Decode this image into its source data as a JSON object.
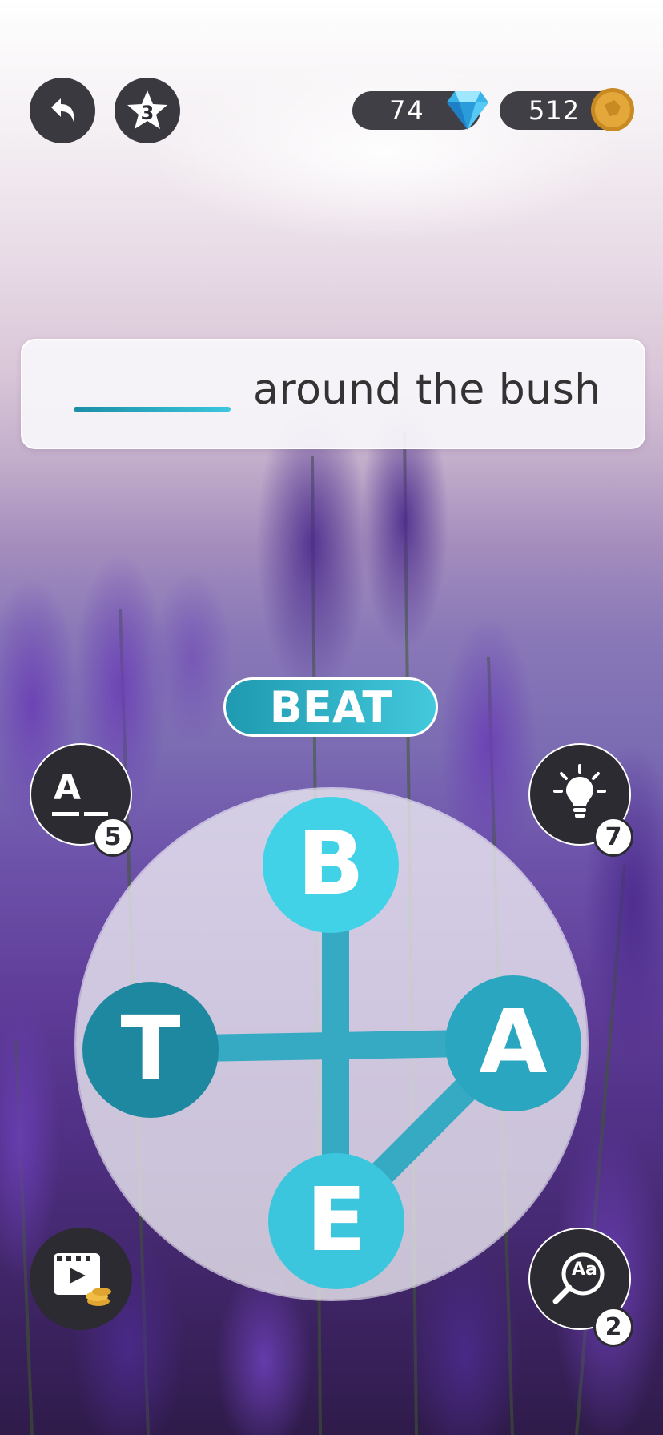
{
  "top_bar": {
    "undo_icon": "undo-arrow-icon",
    "star_level": "3",
    "gems": "74",
    "coins": "512"
  },
  "clue": {
    "text": "around the bush"
  },
  "current_word": "BEAT",
  "letters": {
    "top": "B",
    "left": "T",
    "right": "A",
    "bottom": "E"
  },
  "hints": {
    "reveal_letter_label": "A",
    "reveal_letter_count": "5",
    "lightbulb_count": "7",
    "magnifier_label": "Aa",
    "magnifier_count": "2"
  },
  "colors": {
    "accent_dark": "#1f8ea4",
    "accent_light": "#43d0e4",
    "button_dark": "#2c2b31"
  }
}
